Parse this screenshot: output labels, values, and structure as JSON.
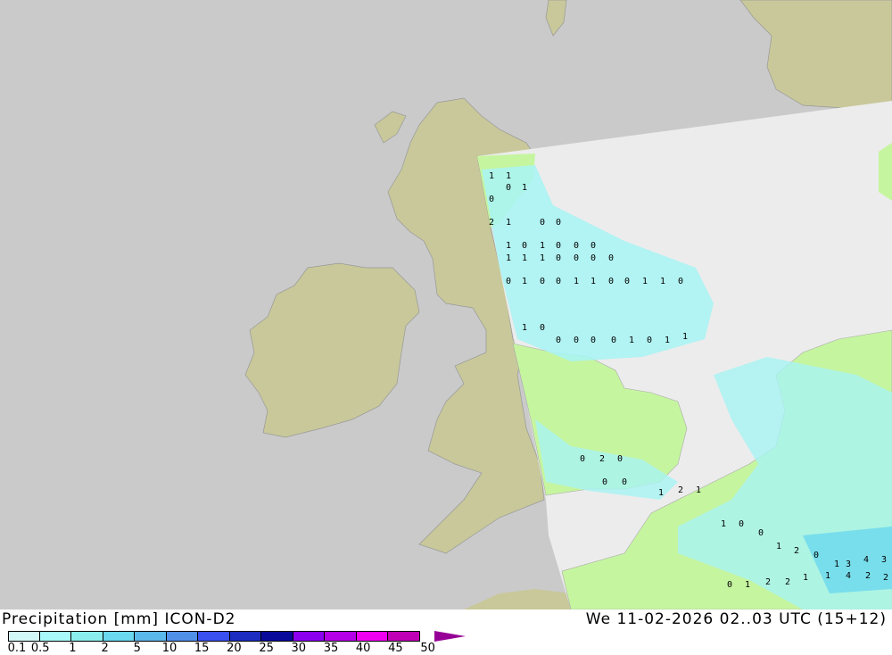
{
  "title": "Precipitation [mm] ICON-D2",
  "timestamp": "We 11-02-2026 02..03 UTC (15+12)",
  "legend": {
    "ticks": [
      "0.1",
      "0.5",
      "1",
      "2",
      "5",
      "10",
      "15",
      "20",
      "25",
      "30",
      "35",
      "40",
      "45",
      "50"
    ],
    "colors": [
      "#d2f8f8",
      "#a8fafa",
      "#8aeeee",
      "#6ad8ee",
      "#5ab8ea",
      "#5090e8",
      "#3a50f0",
      "#1c2cc0",
      "#0a0a9a",
      "#8c00f0",
      "#b400e6",
      "#f000f0",
      "#c000b4",
      "#960096"
    ]
  },
  "map_colors": {
    "sea_outside": "#cacaca",
    "sea_domain": "#ececec",
    "land_outside": "#c8c89a",
    "land_domain": "#c6f5a0",
    "rain_light": "#a8f4f4",
    "rain_mid": "#7ee6ee"
  },
  "grid_values": [
    "1",
    "1",
    "0",
    "1",
    "0",
    "2",
    "1",
    "0",
    "0",
    "1",
    "0",
    "1",
    "0",
    "0",
    "0",
    "1",
    "1",
    "1",
    "0",
    "0",
    "0",
    "0",
    "0",
    "1",
    "0",
    "0",
    "1",
    "1",
    "0",
    "0",
    "1",
    "1",
    "0",
    "1",
    "0",
    "0",
    "0",
    "0",
    "0",
    "1",
    "0",
    "1",
    "1",
    "0",
    "2",
    "0",
    "0",
    "0",
    "1",
    "2",
    "1",
    "1",
    "0",
    "0",
    "1",
    "2",
    "0",
    "1",
    "3",
    "4",
    "3",
    "1",
    "4",
    "2",
    "2",
    "0",
    "1",
    "2",
    "2",
    "1"
  ]
}
